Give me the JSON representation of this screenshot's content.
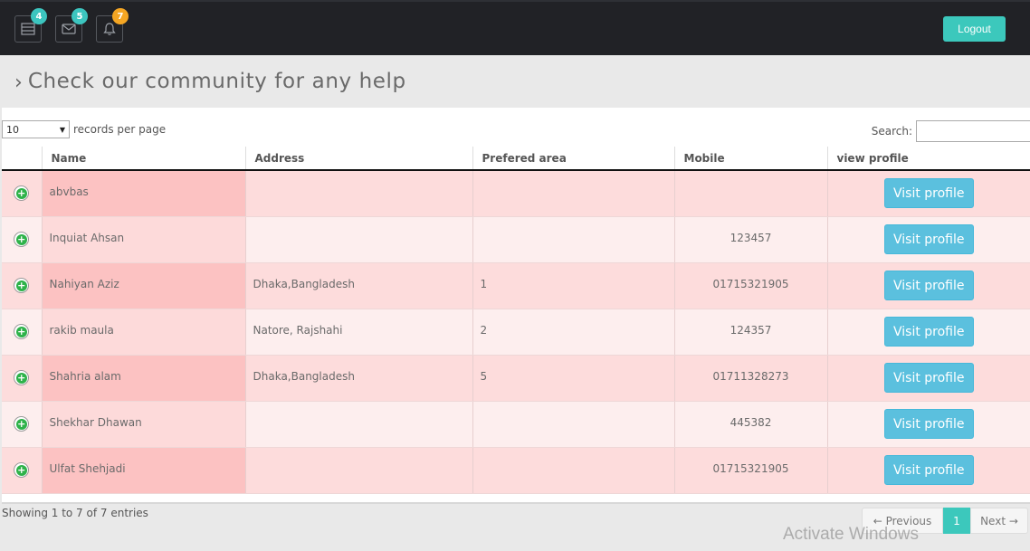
{
  "topbar": {
    "badges": {
      "tasks": "4",
      "messages": "5",
      "notifications": "7"
    },
    "logout_label": "Logout",
    "colors": {
      "bar": "#212226",
      "accent": "#3cc8bc",
      "badge_orange": "#f5a623"
    }
  },
  "page": {
    "title": "Check our community for any help"
  },
  "table_controls": {
    "page_length": "10",
    "records_per_page_label": "records per page",
    "search_label": "Search:",
    "search_value": ""
  },
  "table": {
    "columns": [
      "",
      "Name",
      "Address",
      "Prefered area",
      "Mobile",
      "view profile"
    ],
    "button_label": "Visit profile",
    "rows": [
      {
        "name": "abvbas",
        "address": "",
        "area": "",
        "mobile": ""
      },
      {
        "name": "Inquiat Ahsan",
        "address": "",
        "area": "",
        "mobile": "123457"
      },
      {
        "name": "Nahiyan Aziz",
        "address": "Dhaka,Bangladesh",
        "area": "1",
        "mobile": "01715321905"
      },
      {
        "name": "rakib maula",
        "address": "Natore, Rajshahi",
        "area": "2",
        "mobile": "124357"
      },
      {
        "name": "Shahria alam",
        "address": "Dhaka,Bangladesh",
        "area": "5",
        "mobile": "01711328273"
      },
      {
        "name": "Shekhar Dhawan",
        "address": "",
        "area": "",
        "mobile": "445382"
      },
      {
        "name": "Ulfat Shehjadi",
        "address": "",
        "area": "",
        "mobile": "01715321905"
      }
    ]
  },
  "footer": {
    "info": "Showing 1 to 7 of 7 entries",
    "prev_label": "← Previous",
    "current_page": "1",
    "next_label": "Next →"
  },
  "watermark": "Activate Windows"
}
